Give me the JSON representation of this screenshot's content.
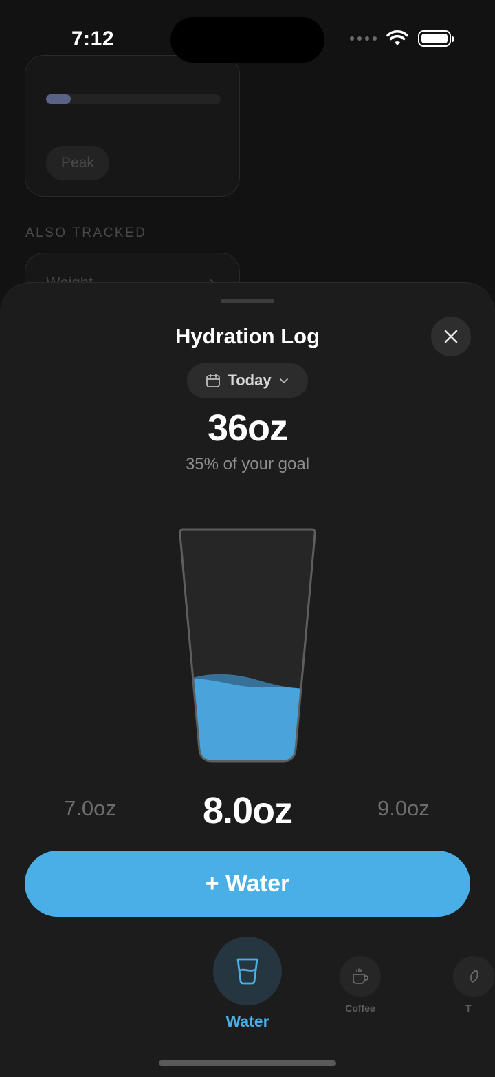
{
  "status_bar": {
    "time": "7:12",
    "wifi_icon": "wifi-icon",
    "battery_icon": "battery-icon"
  },
  "background": {
    "card_chip": "Peak",
    "card_progress": 0.14,
    "section_title": "ALSO TRACKED",
    "tracked_item": "Weight"
  },
  "sheet": {
    "title": "Hydration Log",
    "close_icon": "close-icon",
    "date_filter": {
      "label": "Today",
      "icon": "calendar-icon",
      "chevron": "chevron-down-icon"
    },
    "total": "36oz",
    "goal_text": "35% of your goal",
    "glass_fill_fraction": 0.35,
    "amount_picker": {
      "previous": "7.0oz",
      "current": "8.0oz",
      "next": "9.0oz"
    },
    "add_button_label": "+ Water",
    "drinks": [
      {
        "name": "Water",
        "icon": "water-glass-icon",
        "selected": true
      },
      {
        "name": "Coffee",
        "icon": "coffee-cup-icon",
        "selected": false
      },
      {
        "name": "T",
        "icon": "tea-icon",
        "selected": false
      }
    ]
  },
  "colors": {
    "accent": "#4aaee7",
    "sheet_bg": "#1c1c1d",
    "water": "#4aaee7"
  }
}
